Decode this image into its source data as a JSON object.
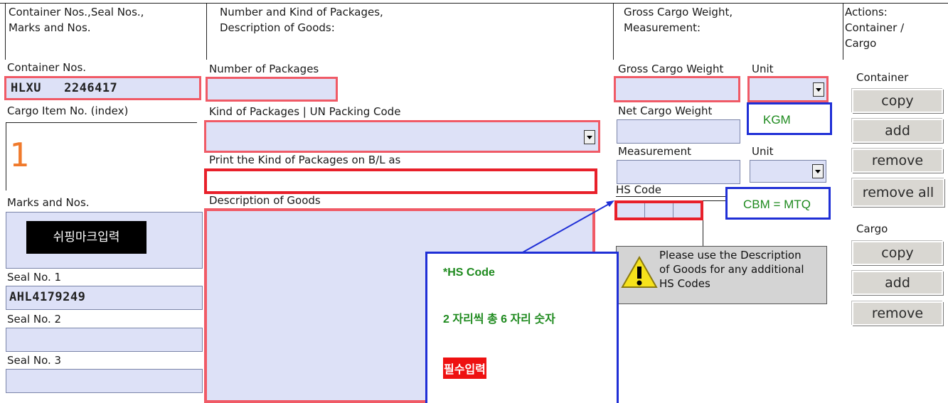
{
  "headers": {
    "col1": [
      "Container Nos.,Seal Nos.,",
      "Marks and Nos."
    ],
    "col2": [
      "Number and Kind of Packages,",
      "Description of Goods:"
    ],
    "col3": [
      "Gross Cargo Weight,",
      "Measurement:"
    ],
    "col4": [
      "Actions:",
      "Container /",
      "Cargo"
    ]
  },
  "left": {
    "container_nos_label": "Container Nos.",
    "container_nos_value": "HLXU   2246417",
    "cargo_item_label": "Cargo Item No. (index)",
    "cargo_item_index": "1",
    "marks_label": "Marks and Nos.",
    "marks_button": "쉬핑마크입력",
    "seal1_label": "Seal No. 1",
    "seal1_value": "AHL4179249",
    "seal2_label": "Seal No. 2",
    "seal3_label": "Seal No. 3"
  },
  "middle": {
    "num_packages_label": "Number of Packages",
    "kind_packages_label": "Kind of Packages | UN Packing Code",
    "print_kind_label": "Print the Kind of Packages on B/L as",
    "description_label": "Description of Goods"
  },
  "weight": {
    "gross_label": "Gross Cargo Weight",
    "unit_label": "Unit",
    "net_label": "Net Cargo Weight",
    "measurement_label": "Measurement",
    "unit2_label": "Unit",
    "hs_label": "HS Code",
    "hs_note": [
      "Please use the Description",
      "of Goods for any additional",
      "HS Codes"
    ]
  },
  "annotations": {
    "kgm": "KGM",
    "cbm": "CBM = MTQ",
    "hs_title": "*HS Code",
    "hs_desc": "2 자리씩 총 6 자리 숫자",
    "required": "필수입력"
  },
  "actions": {
    "container_label": "Container",
    "container_buttons": [
      "copy",
      "add",
      "remove",
      "remove all"
    ],
    "cargo_label": "Cargo",
    "cargo_buttons": [
      "copy",
      "add",
      "remove"
    ]
  },
  "colors": {
    "field_bg": "#dde1f7",
    "mandatory_border": "#f05a66",
    "annotation_blue": "#1f2fd6",
    "annotation_green": "#1e8a1e",
    "required_bg": "#ee1111"
  }
}
